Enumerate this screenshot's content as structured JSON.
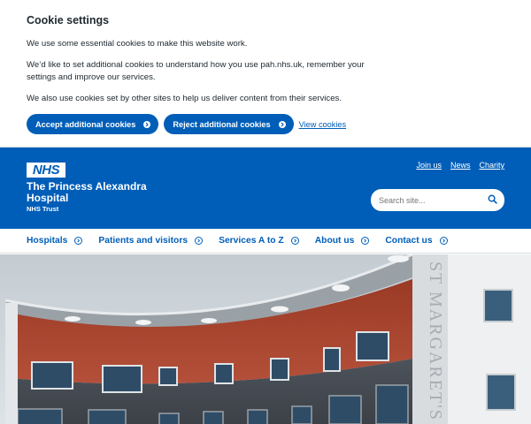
{
  "cookie_banner": {
    "title": "Cookie settings",
    "para1": "We use some essential cookies to make this website work.",
    "para2": "We’d like to set additional cookies to understand how you use pah.nhs.uk, remember your settings and improve our services.",
    "para3": "We also use cookies set by other sites to help us deliver content from their services.",
    "accept_label": "Accept additional cookies",
    "reject_label": "Reject additional cookies",
    "view_label": "View cookies"
  },
  "header": {
    "logo_text": "NHS",
    "org_line1": "The Princess Alexandra",
    "org_line2": "Hospital",
    "org_line3": "NHS Trust",
    "links": [
      "Join us",
      "News",
      "Charity"
    ],
    "search_placeholder": "Search site..."
  },
  "nav": {
    "items": [
      "Hospitals",
      "Patients and visitors",
      "Services A to Z",
      "About us",
      "Contact us"
    ]
  },
  "hero": {
    "building_sign": "ST MARGARET'S"
  },
  "colors": {
    "nhs_blue": "#005eb8",
    "text": "#212b32",
    "white": "#ffffff"
  }
}
